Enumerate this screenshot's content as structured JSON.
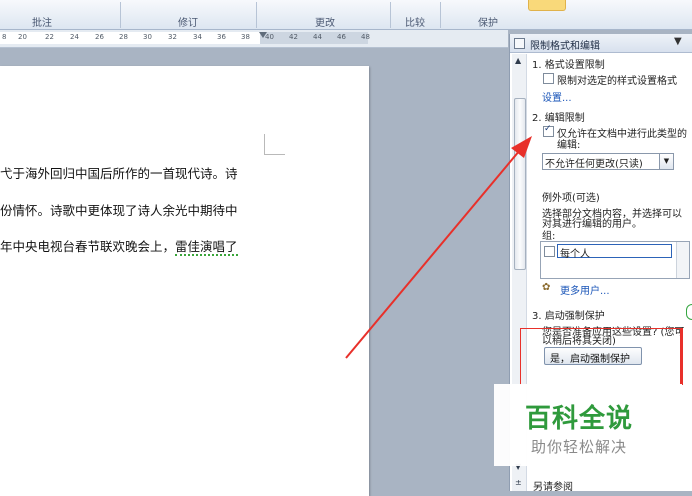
{
  "ribbon": {
    "groups": [
      "批注",
      "修订",
      "更改",
      "比较",
      "保护"
    ]
  },
  "ruler": {
    "ticks": [
      "8",
      "20",
      "22",
      "24",
      "26",
      "28",
      "30",
      "32",
      "34",
      "36",
      "38",
      "40",
      "42",
      "44",
      "46",
      "48"
    ]
  },
  "document": {
    "lines": [
      "弋于海外回归中国后所作的一首现代诗。诗",
      "份情怀。诗歌中更体现了诗人余光中期待中",
      "年中央电视台春节联欢晚会上，雷佳演唱了"
    ],
    "line3_prefix": "年中央电视台春节联欢晚会上，",
    "line3_underlined": "雷佳演唱了"
  },
  "pane": {
    "title": "限制格式和编辑",
    "menu_glyph": "▼",
    "section1_title": "1. 格式设置限制",
    "section1_checkbox": "限制对选定的样式设置格式",
    "section1_link": "设置...",
    "section2_title": "2. 编辑限制",
    "section2_checkbox_line1": "仅允许在文档中进行此类型的",
    "section2_checkbox_line2": "编辑:",
    "section2_checked": true,
    "dropdown_value": "不允许任何更改(只读)",
    "exceptions_title": "例外项(可选)",
    "exceptions_desc_line1": "选择部分文档内容，并选择可以",
    "exceptions_desc_line2": "对其进行编辑的用户。",
    "groups_label": "组:",
    "group_everyone": "每个人",
    "more_users": "更多用户...",
    "section3_title": "3. 启动强制保护",
    "section3_desc_line1": "您是否准备应用这些设置? (您可",
    "section3_desc_line2": "以稍后将其关闭)",
    "start_button": "是，启动强制保护",
    "bottom_link": "另请参阅"
  },
  "watermark": {
    "title": "百科全说",
    "subtitle": "助你轻松解决"
  },
  "colors": {
    "accent_red": "#e8302a",
    "watermark_green": "#2f9a3c",
    "link_blue": "#1a55b8"
  }
}
